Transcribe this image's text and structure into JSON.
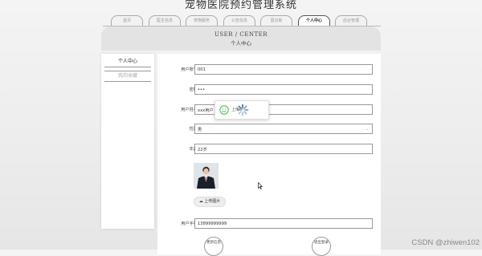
{
  "site_title": "宠物医院预约管理系统",
  "nav": {
    "tabs": [
      "首页",
      "医生信息",
      "宠物服务",
      "公告信息",
      "留言板",
      "个人中心",
      "后台管理"
    ],
    "active_index": 5
  },
  "banner": {
    "title_en": "USER / CENTER",
    "title_cn": "个人中心"
  },
  "sidebar": {
    "items": [
      {
        "label": "个人中心"
      },
      {
        "label": "我的收藏"
      }
    ]
  },
  "form": {
    "account_label": "用户账号",
    "account_value": "001",
    "password_label": "密码",
    "password_value": "•••",
    "name_label": "用户姓名",
    "name_value": "xxx用户",
    "gender_label": "性别",
    "gender_value": "男",
    "age_label": "年龄",
    "age_value": "22岁",
    "upload_label": "上传图片",
    "phone_label": "用户手机",
    "phone_value": "13899999999",
    "update_button": "更新信息",
    "logout_button": "退出登录"
  },
  "popup": {
    "text": "上传中"
  },
  "watermark": "CSDN @zhiwen102",
  "colors": {
    "accent": "#555555",
    "success_icon": "#5cb85c",
    "loader": "#3a6a9b"
  }
}
